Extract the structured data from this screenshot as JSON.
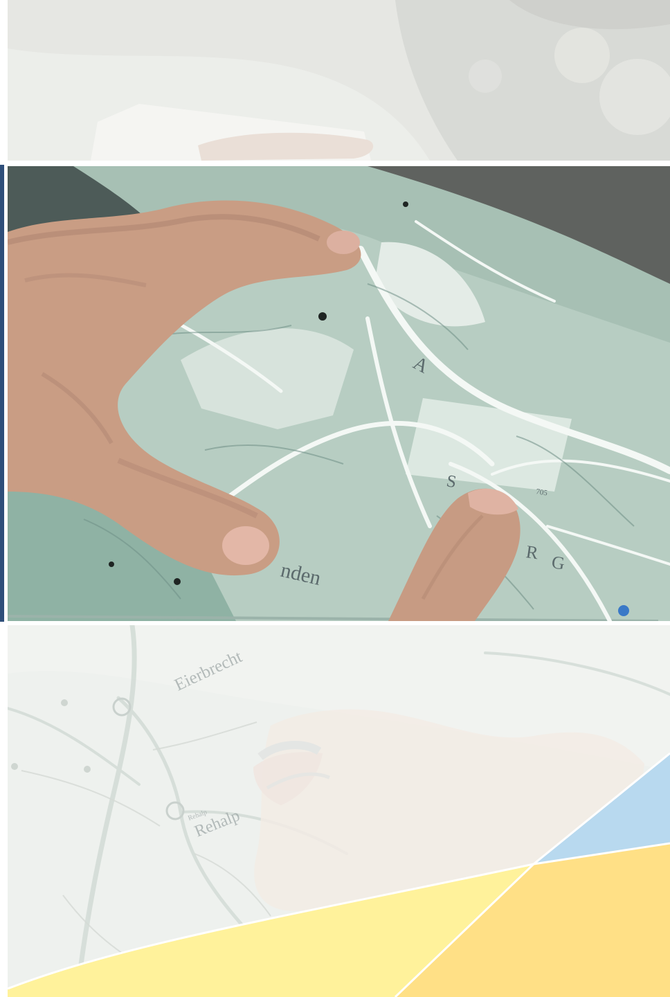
{
  "image": {
    "subject": "hands-reading-map",
    "colors": {
      "page_background": "#ffffff",
      "left_accent_bar": "#2f4f7a",
      "map_green": "#a6c1b5",
      "map_light": "#d9e6dd",
      "road_white": "#f4f8f5",
      "skin": "#c99d84",
      "stone": "#5f625f",
      "faded_map": "#eef1ee",
      "yellow_a": "#fff29b",
      "yellow_b": "#ffe086",
      "blue_corner": "#b8d9ef"
    }
  },
  "panels": {
    "middle": {
      "map_label_1": "A",
      "map_label_2": "S",
      "map_label_3": "R",
      "map_label_4": "G",
      "map_label_5": "nden",
      "map_number": "705"
    },
    "bottom": {
      "label_1": "Eierbrecht",
      "label_2": "Rehalp",
      "label_3": "Rehalp"
    }
  }
}
